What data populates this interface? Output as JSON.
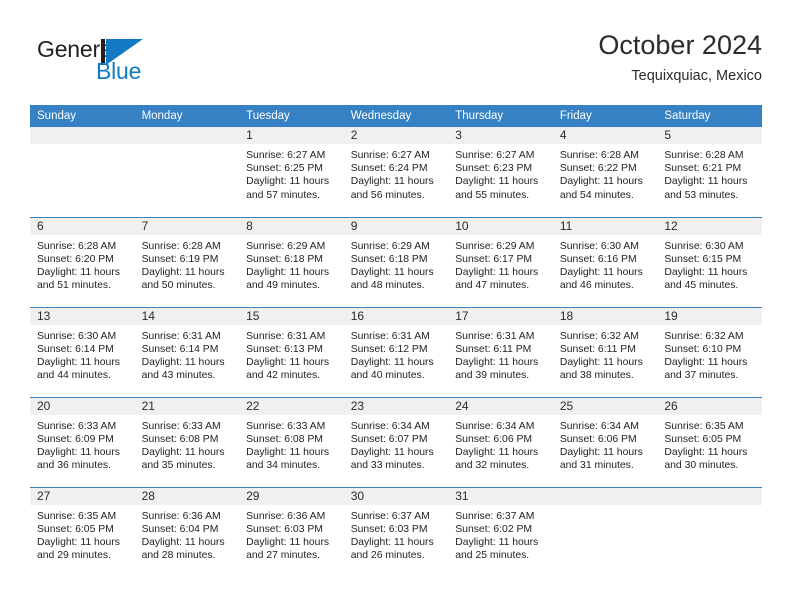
{
  "brand": {
    "name_part1": "General",
    "name_part2": "Blue",
    "logo_icon": "general-blue-triangle-logo",
    "color_dark": "#231f20",
    "color_blue": "#1279c4"
  },
  "header": {
    "title": "October 2024",
    "subtitle": "Tequixquiac, Mexico"
  },
  "calendar": {
    "header_background": "#3581c4",
    "daynum_background": "#f0f0f0",
    "weekday_headers": [
      "Sunday",
      "Monday",
      "Tuesday",
      "Wednesday",
      "Thursday",
      "Friday",
      "Saturday"
    ],
    "weeks": [
      [
        {
          "day": "",
          "sunrise": "",
          "sunset": "",
          "daylight_line1": "",
          "daylight_line2": ""
        },
        {
          "day": "",
          "sunrise": "",
          "sunset": "",
          "daylight_line1": "",
          "daylight_line2": ""
        },
        {
          "day": "1",
          "sunrise": "Sunrise: 6:27 AM",
          "sunset": "Sunset: 6:25 PM",
          "daylight_line1": "Daylight: 11 hours",
          "daylight_line2": "and 57 minutes."
        },
        {
          "day": "2",
          "sunrise": "Sunrise: 6:27 AM",
          "sunset": "Sunset: 6:24 PM",
          "daylight_line1": "Daylight: 11 hours",
          "daylight_line2": "and 56 minutes."
        },
        {
          "day": "3",
          "sunrise": "Sunrise: 6:27 AM",
          "sunset": "Sunset: 6:23 PM",
          "daylight_line1": "Daylight: 11 hours",
          "daylight_line2": "and 55 minutes."
        },
        {
          "day": "4",
          "sunrise": "Sunrise: 6:28 AM",
          "sunset": "Sunset: 6:22 PM",
          "daylight_line1": "Daylight: 11 hours",
          "daylight_line2": "and 54 minutes."
        },
        {
          "day": "5",
          "sunrise": "Sunrise: 6:28 AM",
          "sunset": "Sunset: 6:21 PM",
          "daylight_line1": "Daylight: 11 hours",
          "daylight_line2": "and 53 minutes."
        }
      ],
      [
        {
          "day": "6",
          "sunrise": "Sunrise: 6:28 AM",
          "sunset": "Sunset: 6:20 PM",
          "daylight_line1": "Daylight: 11 hours",
          "daylight_line2": "and 51 minutes."
        },
        {
          "day": "7",
          "sunrise": "Sunrise: 6:28 AM",
          "sunset": "Sunset: 6:19 PM",
          "daylight_line1": "Daylight: 11 hours",
          "daylight_line2": "and 50 minutes."
        },
        {
          "day": "8",
          "sunrise": "Sunrise: 6:29 AM",
          "sunset": "Sunset: 6:18 PM",
          "daylight_line1": "Daylight: 11 hours",
          "daylight_line2": "and 49 minutes."
        },
        {
          "day": "9",
          "sunrise": "Sunrise: 6:29 AM",
          "sunset": "Sunset: 6:18 PM",
          "daylight_line1": "Daylight: 11 hours",
          "daylight_line2": "and 48 minutes."
        },
        {
          "day": "10",
          "sunrise": "Sunrise: 6:29 AM",
          "sunset": "Sunset: 6:17 PM",
          "daylight_line1": "Daylight: 11 hours",
          "daylight_line2": "and 47 minutes."
        },
        {
          "day": "11",
          "sunrise": "Sunrise: 6:30 AM",
          "sunset": "Sunset: 6:16 PM",
          "daylight_line1": "Daylight: 11 hours",
          "daylight_line2": "and 46 minutes."
        },
        {
          "day": "12",
          "sunrise": "Sunrise: 6:30 AM",
          "sunset": "Sunset: 6:15 PM",
          "daylight_line1": "Daylight: 11 hours",
          "daylight_line2": "and 45 minutes."
        }
      ],
      [
        {
          "day": "13",
          "sunrise": "Sunrise: 6:30 AM",
          "sunset": "Sunset: 6:14 PM",
          "daylight_line1": "Daylight: 11 hours",
          "daylight_line2": "and 44 minutes."
        },
        {
          "day": "14",
          "sunrise": "Sunrise: 6:31 AM",
          "sunset": "Sunset: 6:14 PM",
          "daylight_line1": "Daylight: 11 hours",
          "daylight_line2": "and 43 minutes."
        },
        {
          "day": "15",
          "sunrise": "Sunrise: 6:31 AM",
          "sunset": "Sunset: 6:13 PM",
          "daylight_line1": "Daylight: 11 hours",
          "daylight_line2": "and 42 minutes."
        },
        {
          "day": "16",
          "sunrise": "Sunrise: 6:31 AM",
          "sunset": "Sunset: 6:12 PM",
          "daylight_line1": "Daylight: 11 hours",
          "daylight_line2": "and 40 minutes."
        },
        {
          "day": "17",
          "sunrise": "Sunrise: 6:31 AM",
          "sunset": "Sunset: 6:11 PM",
          "daylight_line1": "Daylight: 11 hours",
          "daylight_line2": "and 39 minutes."
        },
        {
          "day": "18",
          "sunrise": "Sunrise: 6:32 AM",
          "sunset": "Sunset: 6:11 PM",
          "daylight_line1": "Daylight: 11 hours",
          "daylight_line2": "and 38 minutes."
        },
        {
          "day": "19",
          "sunrise": "Sunrise: 6:32 AM",
          "sunset": "Sunset: 6:10 PM",
          "daylight_line1": "Daylight: 11 hours",
          "daylight_line2": "and 37 minutes."
        }
      ],
      [
        {
          "day": "20",
          "sunrise": "Sunrise: 6:33 AM",
          "sunset": "Sunset: 6:09 PM",
          "daylight_line1": "Daylight: 11 hours",
          "daylight_line2": "and 36 minutes."
        },
        {
          "day": "21",
          "sunrise": "Sunrise: 6:33 AM",
          "sunset": "Sunset: 6:08 PM",
          "daylight_line1": "Daylight: 11 hours",
          "daylight_line2": "and 35 minutes."
        },
        {
          "day": "22",
          "sunrise": "Sunrise: 6:33 AM",
          "sunset": "Sunset: 6:08 PM",
          "daylight_line1": "Daylight: 11 hours",
          "daylight_line2": "and 34 minutes."
        },
        {
          "day": "23",
          "sunrise": "Sunrise: 6:34 AM",
          "sunset": "Sunset: 6:07 PM",
          "daylight_line1": "Daylight: 11 hours",
          "daylight_line2": "and 33 minutes."
        },
        {
          "day": "24",
          "sunrise": "Sunrise: 6:34 AM",
          "sunset": "Sunset: 6:06 PM",
          "daylight_line1": "Daylight: 11 hours",
          "daylight_line2": "and 32 minutes."
        },
        {
          "day": "25",
          "sunrise": "Sunrise: 6:34 AM",
          "sunset": "Sunset: 6:06 PM",
          "daylight_line1": "Daylight: 11 hours",
          "daylight_line2": "and 31 minutes."
        },
        {
          "day": "26",
          "sunrise": "Sunrise: 6:35 AM",
          "sunset": "Sunset: 6:05 PM",
          "daylight_line1": "Daylight: 11 hours",
          "daylight_line2": "and 30 minutes."
        }
      ],
      [
        {
          "day": "27",
          "sunrise": "Sunrise: 6:35 AM",
          "sunset": "Sunset: 6:05 PM",
          "daylight_line1": "Daylight: 11 hours",
          "daylight_line2": "and 29 minutes."
        },
        {
          "day": "28",
          "sunrise": "Sunrise: 6:36 AM",
          "sunset": "Sunset: 6:04 PM",
          "daylight_line1": "Daylight: 11 hours",
          "daylight_line2": "and 28 minutes."
        },
        {
          "day": "29",
          "sunrise": "Sunrise: 6:36 AM",
          "sunset": "Sunset: 6:03 PM",
          "daylight_line1": "Daylight: 11 hours",
          "daylight_line2": "and 27 minutes."
        },
        {
          "day": "30",
          "sunrise": "Sunrise: 6:37 AM",
          "sunset": "Sunset: 6:03 PM",
          "daylight_line1": "Daylight: 11 hours",
          "daylight_line2": "and 26 minutes."
        },
        {
          "day": "31",
          "sunrise": "Sunrise: 6:37 AM",
          "sunset": "Sunset: 6:02 PM",
          "daylight_line1": "Daylight: 11 hours",
          "daylight_line2": "and 25 minutes."
        },
        {
          "day": "",
          "sunrise": "",
          "sunset": "",
          "daylight_line1": "",
          "daylight_line2": ""
        },
        {
          "day": "",
          "sunrise": "",
          "sunset": "",
          "daylight_line1": "",
          "daylight_line2": ""
        }
      ]
    ]
  }
}
